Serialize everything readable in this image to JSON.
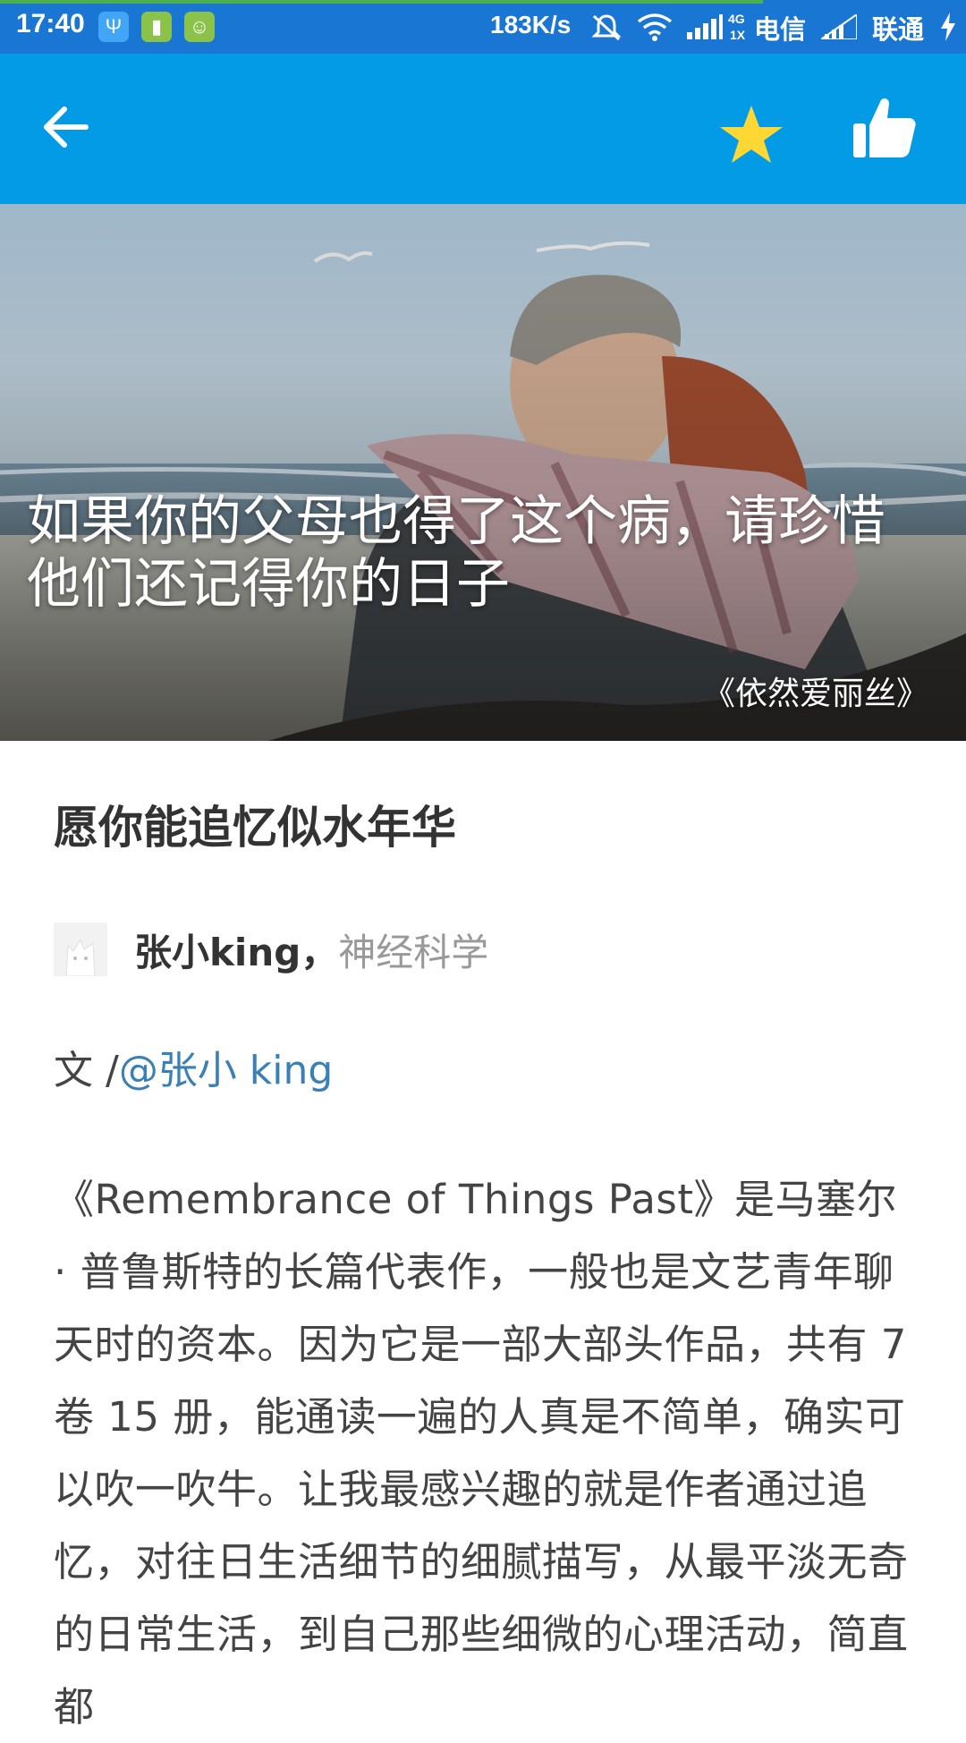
{
  "status_bar": {
    "time": "17:40",
    "speed": "183K/s",
    "signal_label_top": "4G",
    "signal_label_bottom": "1X",
    "carrier1": "电信",
    "carrier2": "联通"
  },
  "app_bar": {
    "back_icon": "arrow-left-icon",
    "star_icon": "star-icon",
    "like_icon": "thumbs-up-icon",
    "colors": {
      "bar": "#039BE5",
      "star": "#FDD835"
    }
  },
  "hero": {
    "title": "如果你的父母也得了这个病，请珍惜他们还记得你的日子",
    "source": "《依然爱丽丝》"
  },
  "article": {
    "title": "愿你能追忆似水年华",
    "author_name": "张小king，",
    "author_tag": "神经科学",
    "byline_prefix": "文 /",
    "byline_handle": "@张小 king",
    "body": "《Remembrance of Things Past》是马塞尔 · 普鲁斯特的长篇代表作，一般也是文艺青年聊天时的资本。因为它是一部大部头作品，共有 7 卷 15 册，能通读一遍的人真是不简单，确实可以吹一吹牛。让我最感兴趣的就是作者通过追忆，对往日生活细节的细腻描写，从最平淡无奇的日常生活，到自己那些细微的心理活动，简直都"
  }
}
